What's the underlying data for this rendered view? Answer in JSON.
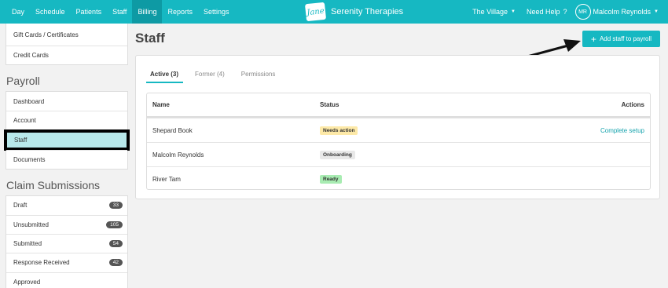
{
  "nav": {
    "items": [
      {
        "label": "Day"
      },
      {
        "label": "Schedule"
      },
      {
        "label": "Patients"
      },
      {
        "label": "Staff"
      },
      {
        "label": "Billing"
      },
      {
        "label": "Reports"
      },
      {
        "label": "Settings"
      }
    ],
    "active": "Billing",
    "brand_logo": "Jane",
    "brand_name": "Serenity Therapies",
    "location": "The Village",
    "help": "Need Help",
    "help_icon": "?",
    "avatar_initials": "MR",
    "user_name": "Malcolm Reynolds"
  },
  "sidebar": {
    "top_items": [
      {
        "label": "Gift Cards / Certificates"
      },
      {
        "label": "Credit Cards"
      }
    ],
    "payroll_heading": "Payroll",
    "payroll_items": [
      {
        "label": "Dashboard"
      },
      {
        "label": "Account"
      },
      {
        "label": "Staff"
      },
      {
        "label": "Documents"
      }
    ],
    "claims_heading": "Claim Submissions",
    "claims_items": [
      {
        "label": "Draft",
        "count": "33"
      },
      {
        "label": "Unsubmitted",
        "count": "105"
      },
      {
        "label": "Submitted",
        "count": "54"
      },
      {
        "label": "Response Received",
        "count": "42"
      },
      {
        "label": "Approved",
        "count": ""
      }
    ]
  },
  "main": {
    "title": "Staff",
    "add_button": "Add staff to payroll",
    "tabs": [
      {
        "label": "Active (3)"
      },
      {
        "label": "Former (4)"
      },
      {
        "label": "Permissions"
      }
    ],
    "table": {
      "headers": {
        "name": "Name",
        "status": "Status",
        "actions": "Actions"
      },
      "rows": [
        {
          "name": "Shepard Book",
          "status": "Needs action",
          "action": "Complete setup"
        },
        {
          "name": "Malcolm Reynolds",
          "status": "Onboarding",
          "action": ""
        },
        {
          "name": "River Tam",
          "status": "Ready",
          "action": ""
        }
      ]
    }
  },
  "colors": {
    "accent": "#16b8c2",
    "accent_dark": "#0e9aa4",
    "selected_bg": "#b8e8ea",
    "tag_warn": "#fde9a8",
    "tag_ok": "#a8ecb2"
  }
}
